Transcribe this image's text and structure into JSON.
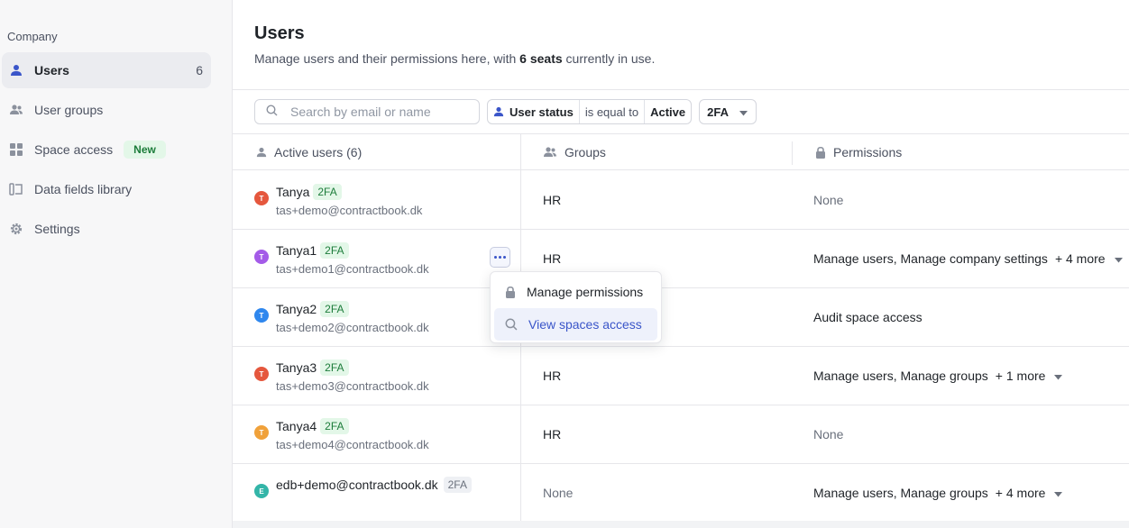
{
  "sidebar": {
    "section_label": "Company",
    "items": [
      {
        "label": "Users",
        "count": "6",
        "icon": "user-icon"
      },
      {
        "label": "User groups",
        "icon": "users-icon"
      },
      {
        "label": "Space access",
        "badge": "New",
        "icon": "grid-icon"
      },
      {
        "label": "Data fields library",
        "icon": "library-icon"
      },
      {
        "label": "Settings",
        "icon": "gear-icon"
      }
    ]
  },
  "header": {
    "title": "Users",
    "subtitle_before": "Manage users and their permissions here, with ",
    "subtitle_bold": "6 seats",
    "subtitle_after": " currently in use."
  },
  "toolbar": {
    "search_placeholder": "Search by email or name",
    "filter": {
      "field": "User status",
      "operator": "is equal to",
      "value": "Active"
    },
    "dropdown_label": "2FA"
  },
  "table": {
    "columns": {
      "users": "Active users (6)",
      "groups": "Groups",
      "permissions": "Permissions"
    },
    "rows": [
      {
        "avatar": "T",
        "name": "Tanya",
        "badge": "2FA",
        "email": "tas+demo@contractbook.dk",
        "groups": "HR",
        "permissions": "None",
        "more": ""
      },
      {
        "avatar": "T",
        "name": "Tanya1",
        "badge": "2FA",
        "email": "tas+demo1@contractbook.dk",
        "groups": "HR",
        "permissions": "Manage users, Manage company settings",
        "more": "+ 4 more"
      },
      {
        "avatar": "T",
        "name": "Tanya2",
        "badge": "2FA",
        "email": "tas+demo2@contractbook.dk",
        "groups": "",
        "permissions": "Audit space access",
        "more": ""
      },
      {
        "avatar": "T",
        "name": "Tanya3",
        "badge": "2FA",
        "email": "tas+demo3@contractbook.dk",
        "groups": "HR",
        "permissions": "Manage users, Manage groups",
        "more": "+ 1 more"
      },
      {
        "avatar": "T",
        "name": "Tanya4",
        "badge": "2FA",
        "email": "tas+demo4@contractbook.dk",
        "groups": "HR",
        "permissions": "None",
        "more": ""
      },
      {
        "avatar": "E",
        "name": "edb+demo@contractbook.dk",
        "badge": "2FA",
        "email": "",
        "groups": "None",
        "permissions": "Manage users, Manage groups",
        "more": "+ 4 more"
      }
    ]
  },
  "row_menu": {
    "items": [
      {
        "label": "Manage permissions",
        "icon": "lock-icon"
      },
      {
        "label": "View spaces access",
        "icon": "search-icon"
      }
    ]
  },
  "colors": {
    "accent": "#3a55c9",
    "avatar_red": "#e5573d",
    "avatar_purple": "#a45be8",
    "avatar_blue": "#2f87ee",
    "avatar_orange": "#f0a13a",
    "avatar_teal": "#33b5a8",
    "badge_green_bg": "#e3f7e8",
    "badge_green_text": "#1c7c3a"
  }
}
